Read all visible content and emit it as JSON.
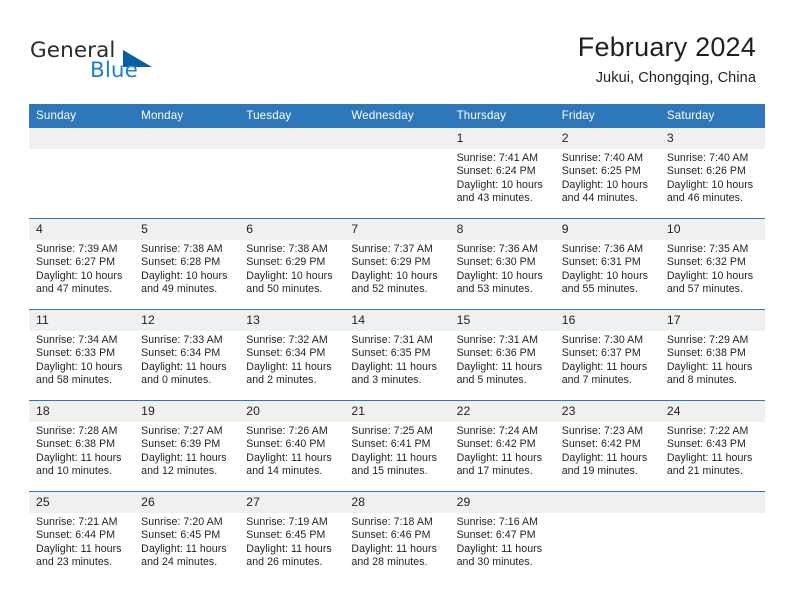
{
  "brand": {
    "word_one": "General",
    "word_two": "Blue",
    "logo_icon": "triangle-logo-icon"
  },
  "header": {
    "title": "February 2024",
    "subtitle": "Jukui, Chongqing, China"
  },
  "colors": {
    "header_blue": "#2e77bb",
    "daynum_band": "#f0f0f0",
    "brand_blue": "#1a7fd4",
    "logo_blue": "#0c5ca5",
    "text": "#231f20"
  },
  "weekdays": [
    "Sunday",
    "Monday",
    "Tuesday",
    "Wednesday",
    "Thursday",
    "Friday",
    "Saturday"
  ],
  "weeks": [
    [
      {
        "day": "",
        "sunrise": "",
        "sunset": "",
        "daylight_line1": "",
        "daylight_line2": ""
      },
      {
        "day": "",
        "sunrise": "",
        "sunset": "",
        "daylight_line1": "",
        "daylight_line2": ""
      },
      {
        "day": "",
        "sunrise": "",
        "sunset": "",
        "daylight_line1": "",
        "daylight_line2": ""
      },
      {
        "day": "",
        "sunrise": "",
        "sunset": "",
        "daylight_line1": "",
        "daylight_line2": ""
      },
      {
        "day": "1",
        "sunrise": "Sunrise: 7:41 AM",
        "sunset": "Sunset: 6:24 PM",
        "daylight_line1": "Daylight: 10 hours",
        "daylight_line2": "and 43 minutes."
      },
      {
        "day": "2",
        "sunrise": "Sunrise: 7:40 AM",
        "sunset": "Sunset: 6:25 PM",
        "daylight_line1": "Daylight: 10 hours",
        "daylight_line2": "and 44 minutes."
      },
      {
        "day": "3",
        "sunrise": "Sunrise: 7:40 AM",
        "sunset": "Sunset: 6:26 PM",
        "daylight_line1": "Daylight: 10 hours",
        "daylight_line2": "and 46 minutes."
      }
    ],
    [
      {
        "day": "4",
        "sunrise": "Sunrise: 7:39 AM",
        "sunset": "Sunset: 6:27 PM",
        "daylight_line1": "Daylight: 10 hours",
        "daylight_line2": "and 47 minutes."
      },
      {
        "day": "5",
        "sunrise": "Sunrise: 7:38 AM",
        "sunset": "Sunset: 6:28 PM",
        "daylight_line1": "Daylight: 10 hours",
        "daylight_line2": "and 49 minutes."
      },
      {
        "day": "6",
        "sunrise": "Sunrise: 7:38 AM",
        "sunset": "Sunset: 6:29 PM",
        "daylight_line1": "Daylight: 10 hours",
        "daylight_line2": "and 50 minutes."
      },
      {
        "day": "7",
        "sunrise": "Sunrise: 7:37 AM",
        "sunset": "Sunset: 6:29 PM",
        "daylight_line1": "Daylight: 10 hours",
        "daylight_line2": "and 52 minutes."
      },
      {
        "day": "8",
        "sunrise": "Sunrise: 7:36 AM",
        "sunset": "Sunset: 6:30 PM",
        "daylight_line1": "Daylight: 10 hours",
        "daylight_line2": "and 53 minutes."
      },
      {
        "day": "9",
        "sunrise": "Sunrise: 7:36 AM",
        "sunset": "Sunset: 6:31 PM",
        "daylight_line1": "Daylight: 10 hours",
        "daylight_line2": "and 55 minutes."
      },
      {
        "day": "10",
        "sunrise": "Sunrise: 7:35 AM",
        "sunset": "Sunset: 6:32 PM",
        "daylight_line1": "Daylight: 10 hours",
        "daylight_line2": "and 57 minutes."
      }
    ],
    [
      {
        "day": "11",
        "sunrise": "Sunrise: 7:34 AM",
        "sunset": "Sunset: 6:33 PM",
        "daylight_line1": "Daylight: 10 hours",
        "daylight_line2": "and 58 minutes."
      },
      {
        "day": "12",
        "sunrise": "Sunrise: 7:33 AM",
        "sunset": "Sunset: 6:34 PM",
        "daylight_line1": "Daylight: 11 hours",
        "daylight_line2": "and 0 minutes."
      },
      {
        "day": "13",
        "sunrise": "Sunrise: 7:32 AM",
        "sunset": "Sunset: 6:34 PM",
        "daylight_line1": "Daylight: 11 hours",
        "daylight_line2": "and 2 minutes."
      },
      {
        "day": "14",
        "sunrise": "Sunrise: 7:31 AM",
        "sunset": "Sunset: 6:35 PM",
        "daylight_line1": "Daylight: 11 hours",
        "daylight_line2": "and 3 minutes."
      },
      {
        "day": "15",
        "sunrise": "Sunrise: 7:31 AM",
        "sunset": "Sunset: 6:36 PM",
        "daylight_line1": "Daylight: 11 hours",
        "daylight_line2": "and 5 minutes."
      },
      {
        "day": "16",
        "sunrise": "Sunrise: 7:30 AM",
        "sunset": "Sunset: 6:37 PM",
        "daylight_line1": "Daylight: 11 hours",
        "daylight_line2": "and 7 minutes."
      },
      {
        "day": "17",
        "sunrise": "Sunrise: 7:29 AM",
        "sunset": "Sunset: 6:38 PM",
        "daylight_line1": "Daylight: 11 hours",
        "daylight_line2": "and 8 minutes."
      }
    ],
    [
      {
        "day": "18",
        "sunrise": "Sunrise: 7:28 AM",
        "sunset": "Sunset: 6:38 PM",
        "daylight_line1": "Daylight: 11 hours",
        "daylight_line2": "and 10 minutes."
      },
      {
        "day": "19",
        "sunrise": "Sunrise: 7:27 AM",
        "sunset": "Sunset: 6:39 PM",
        "daylight_line1": "Daylight: 11 hours",
        "daylight_line2": "and 12 minutes."
      },
      {
        "day": "20",
        "sunrise": "Sunrise: 7:26 AM",
        "sunset": "Sunset: 6:40 PM",
        "daylight_line1": "Daylight: 11 hours",
        "daylight_line2": "and 14 minutes."
      },
      {
        "day": "21",
        "sunrise": "Sunrise: 7:25 AM",
        "sunset": "Sunset: 6:41 PM",
        "daylight_line1": "Daylight: 11 hours",
        "daylight_line2": "and 15 minutes."
      },
      {
        "day": "22",
        "sunrise": "Sunrise: 7:24 AM",
        "sunset": "Sunset: 6:42 PM",
        "daylight_line1": "Daylight: 11 hours",
        "daylight_line2": "and 17 minutes."
      },
      {
        "day": "23",
        "sunrise": "Sunrise: 7:23 AM",
        "sunset": "Sunset: 6:42 PM",
        "daylight_line1": "Daylight: 11 hours",
        "daylight_line2": "and 19 minutes."
      },
      {
        "day": "24",
        "sunrise": "Sunrise: 7:22 AM",
        "sunset": "Sunset: 6:43 PM",
        "daylight_line1": "Daylight: 11 hours",
        "daylight_line2": "and 21 minutes."
      }
    ],
    [
      {
        "day": "25",
        "sunrise": "Sunrise: 7:21 AM",
        "sunset": "Sunset: 6:44 PM",
        "daylight_line1": "Daylight: 11 hours",
        "daylight_line2": "and 23 minutes."
      },
      {
        "day": "26",
        "sunrise": "Sunrise: 7:20 AM",
        "sunset": "Sunset: 6:45 PM",
        "daylight_line1": "Daylight: 11 hours",
        "daylight_line2": "and 24 minutes."
      },
      {
        "day": "27",
        "sunrise": "Sunrise: 7:19 AM",
        "sunset": "Sunset: 6:45 PM",
        "daylight_line1": "Daylight: 11 hours",
        "daylight_line2": "and 26 minutes."
      },
      {
        "day": "28",
        "sunrise": "Sunrise: 7:18 AM",
        "sunset": "Sunset: 6:46 PM",
        "daylight_line1": "Daylight: 11 hours",
        "daylight_line2": "and 28 minutes."
      },
      {
        "day": "29",
        "sunrise": "Sunrise: 7:16 AM",
        "sunset": "Sunset: 6:47 PM",
        "daylight_line1": "Daylight: 11 hours",
        "daylight_line2": "and 30 minutes."
      },
      {
        "day": "",
        "sunrise": "",
        "sunset": "",
        "daylight_line1": "",
        "daylight_line2": ""
      },
      {
        "day": "",
        "sunrise": "",
        "sunset": "",
        "daylight_line1": "",
        "daylight_line2": ""
      }
    ]
  ]
}
